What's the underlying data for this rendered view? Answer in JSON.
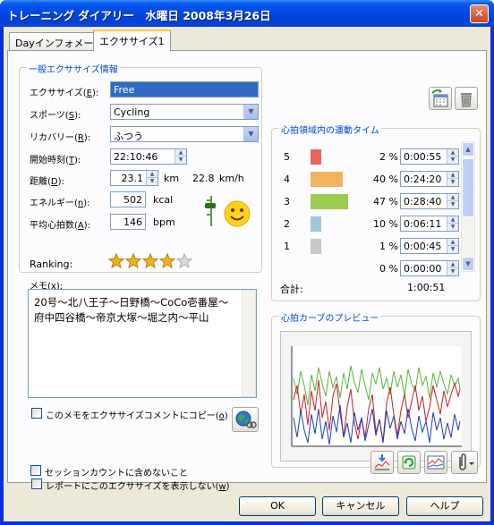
{
  "window": {
    "title": "トレーニング ダイアリー　水曜日 2008年3月26日",
    "close_glyph": "✕"
  },
  "tabs": [
    {
      "label": "Dayインフォメーション",
      "active": false
    },
    {
      "label": "エクササイズ1",
      "active": true
    }
  ],
  "general": {
    "title": "一般エクササイズ情報",
    "exercise_label": "エクササイズ(",
    "exercise_key": "E",
    "exercise_value": "Free",
    "sport_label": "スポーツ(",
    "sport_key": "S",
    "sport_value": "Cycling",
    "recovery_label": "リカバリー(",
    "recovery_key": "R",
    "recovery_value": "ふつう",
    "start_label": "開始時刻(",
    "start_key": "T",
    "start_value": "22:10:46",
    "distance_label": "距離(",
    "distance_key": "D",
    "distance_value": "23.1",
    "distance_unit": "km",
    "speed_value": "22.8",
    "speed_unit": "km/h",
    "energy_label": "エネルギー(",
    "energy_key": "n",
    "energy_value": "502",
    "energy_unit": "kcal",
    "avg_hr_label": "平均心拍数(",
    "avg_hr_key": "A",
    "avg_hr_value": "146",
    "avg_hr_unit": "bpm",
    "ranking_label": "Ranking:",
    "ranking_stars": 4,
    "ranking_max": 5,
    "mood_icon": "smiley-face-icon",
    "close_paren": ")"
  },
  "memo": {
    "label": "メモ(",
    "key": "x",
    "close": "):",
    "text": "20号～北八王子～日野橋～CoCo壱番屋～府中四谷橋～帝京大塚～堀之内～平山",
    "copy_label": "このメモをエクササイズコメントにコピー(",
    "copy_key": "o",
    "copy_close": ")"
  },
  "zones": {
    "title": "心拍領域内の運動タイム",
    "rows": [
      {
        "zone": "5",
        "pct": "2 %",
        "time": "0:00:55",
        "fraction": 0.02,
        "color": "#e8665a"
      },
      {
        "zone": "4",
        "pct": "40 %",
        "time": "0:24:20",
        "fraction": 0.4,
        "color": "#f2b35e"
      },
      {
        "zone": "3",
        "pct": "47 %",
        "time": "0:28:40",
        "fraction": 0.47,
        "color": "#9ccc52"
      },
      {
        "zone": "2",
        "pct": "10 %",
        "time": "0:06:11",
        "fraction": 0.1,
        "color": "#9cc6dc"
      },
      {
        "zone": "1",
        "pct": "1 %",
        "time": "0:00:45",
        "fraction": 0.01,
        "color": "#c8c8c8"
      },
      {
        "zone": "",
        "pct": "0 %",
        "time": "0:00:00",
        "fraction": 0.0,
        "color": "#c8c8c8"
      }
    ],
    "total_label": "合計:",
    "total_value": "1:00:51"
  },
  "preview": {
    "title": "心拍カーブのプレビュー"
  },
  "options": {
    "hide_report_label": "レポートにこのエクササイズを表示しない(",
    "hide_report_key": "w",
    "hide_report_close": ")",
    "exclude_session_label": "セッションカウントに含めないこと"
  },
  "buttons": {
    "ok": "OK",
    "cancel": "キャンセル",
    "help": "ヘルプ"
  },
  "colors": {
    "title_bar": "#0046e0",
    "group_title": "#0046d5",
    "selection": "#316ac5",
    "star": "#f2b21b",
    "star_empty": "#d8d8d8"
  }
}
